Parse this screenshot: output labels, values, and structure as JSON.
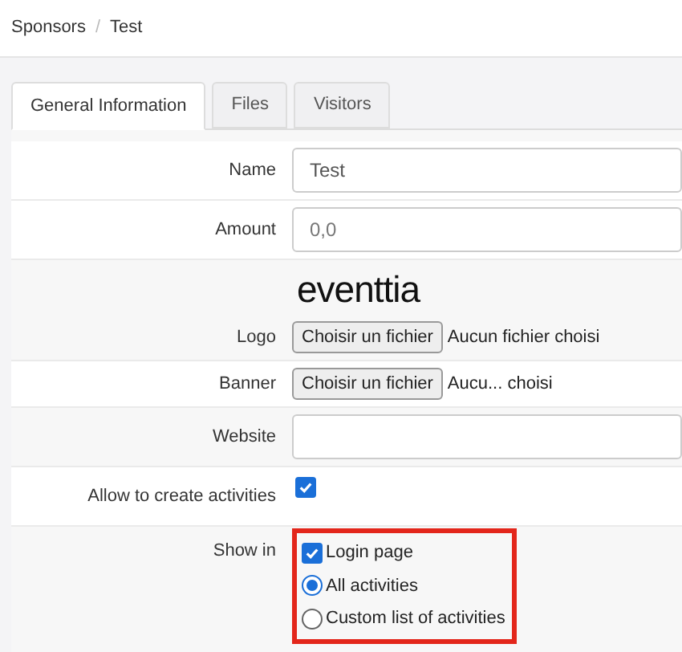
{
  "breadcrumb": [
    "Sponsors",
    "Test"
  ],
  "breadcrumb_separator": "/",
  "tabs": [
    {
      "label": "General Information",
      "selected": true
    },
    {
      "label": "Files",
      "selected": false
    },
    {
      "label": "Visitors",
      "selected": false
    }
  ],
  "form": [
    {
      "kind": "text",
      "label": "Name",
      "value": "Test"
    },
    {
      "kind": "text",
      "label": "Amount",
      "placeholder": "0,0"
    },
    {
      "kind": "file",
      "label": "Logo",
      "logo": "eventtia",
      "button": "Choisir un fichier",
      "status": "Aucun fichier choisi"
    },
    {
      "kind": "file",
      "label": "Banner",
      "button": "Choisir un fichier",
      "status": "Aucu... choisi"
    },
    {
      "kind": "text",
      "label": "Website"
    },
    {
      "kind": "checkbox",
      "label": "Allow to create activities",
      "checked": true
    },
    {
      "kind": "options",
      "label": "Show in",
      "highlighted": true,
      "options": [
        {
          "kind": "checkbox",
          "label": "Login page",
          "checked": true
        },
        {
          "kind": "radio",
          "label": "All activities",
          "selected": true
        },
        {
          "kind": "radio",
          "label": "Custom list of activities",
          "selected": false
        }
      ]
    }
  ]
}
